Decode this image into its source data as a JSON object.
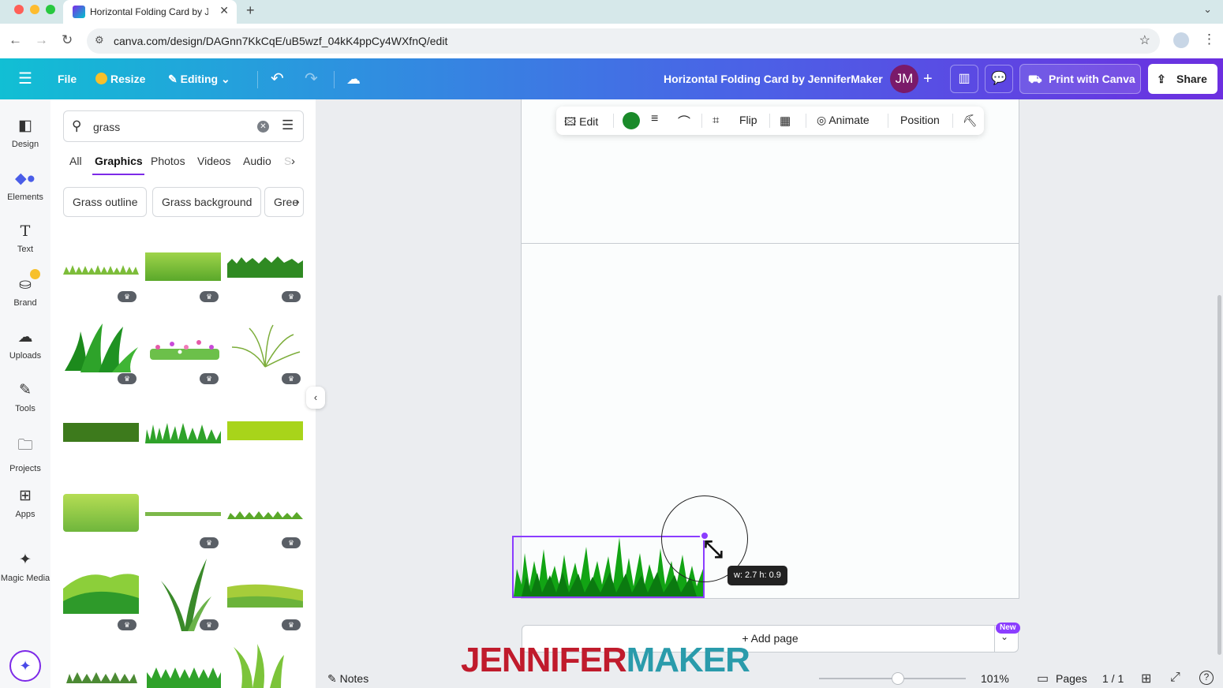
{
  "browser": {
    "tab_title": "Horizontal Folding Card by Je",
    "url": "canva.com/design/DAGnn7KkCqE/uB5wzf_04kK4ppCy4WXfnQ/edit"
  },
  "header": {
    "file": "File",
    "resize": "Resize",
    "editing": "Editing",
    "doc_title": "Horizontal Folding Card by JenniferMaker",
    "avatar_initials": "JM",
    "print_label": "Print with Canva",
    "share_label": "Share",
    "brand_gradient": [
      "#11bfd4",
      "#6c2fe0"
    ]
  },
  "rail": {
    "items": [
      {
        "label": "Design",
        "icon": "layout-icon"
      },
      {
        "label": "Elements",
        "icon": "shapes-icon"
      },
      {
        "label": "Text",
        "icon": "text-icon"
      },
      {
        "label": "Brand",
        "icon": "brand-icon"
      },
      {
        "label": "Uploads",
        "icon": "upload-cloud-icon"
      },
      {
        "label": "Tools",
        "icon": "pen-icon"
      },
      {
        "label": "Projects",
        "icon": "folder-icon"
      },
      {
        "label": "Apps",
        "icon": "apps-icon"
      },
      {
        "label": "Magic Media",
        "icon": "magic-media-icon"
      }
    ]
  },
  "panel": {
    "search_value": "grass",
    "tabs": [
      "All",
      "Graphics",
      "Photos",
      "Videos",
      "Audio",
      "S"
    ],
    "active_tab": "Graphics",
    "chips": [
      "Grass outline",
      "Grass background",
      "Gree"
    ]
  },
  "context_toolbar": {
    "edit": "Edit",
    "color": "#1a8a2a",
    "flip": "Flip",
    "animate": "Animate",
    "position": "Position"
  },
  "canvas": {
    "dimension_tip": "w: 2.7 h: 0.9",
    "add_page": "+ Add page",
    "new_badge": "New"
  },
  "bottom": {
    "notes": "Notes",
    "zoom": "101%",
    "zoom_level": 0.54,
    "pages_label": "Pages",
    "page_count": "1 / 1"
  },
  "watermark": {
    "part1": "JENNIFER",
    "part2": "MAKER"
  }
}
